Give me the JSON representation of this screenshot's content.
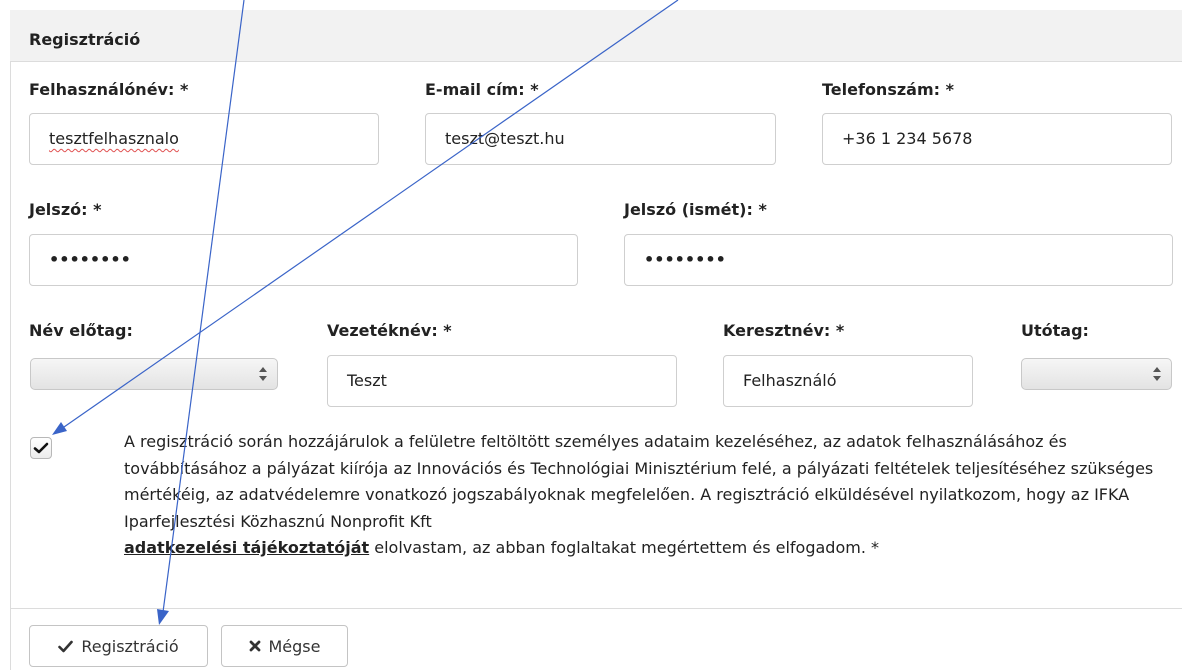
{
  "panel": {
    "title": "Regisztráció"
  },
  "fields": {
    "username": {
      "label": "Felhasználónév: *",
      "value": "tesztfelhasznalo"
    },
    "email": {
      "label": "E-mail cím: *",
      "value": "teszt@teszt.hu"
    },
    "phone": {
      "label": "Telefonszám: *",
      "value": "+36 1 234 5678"
    },
    "password": {
      "label": "Jelszó: *",
      "value": "••••••••"
    },
    "password_again": {
      "label": "Jelszó (ismét): *",
      "value": "••••••••"
    },
    "name_prefix": {
      "label": "Név előtag:",
      "value": ""
    },
    "last_name": {
      "label": "Vezetéknév: *",
      "value": "Teszt"
    },
    "first_name": {
      "label": "Keresztnév: *",
      "value": "Felhasználó"
    },
    "suffix": {
      "label": "Utótag:",
      "value": ""
    }
  },
  "consent": {
    "checked": true,
    "text_before": "A regisztráció során hozzájárulok a felületre feltöltött személyes adataim kezeléséhez, az adatok felhasználásához és továbbításához a pályázat kiírója az Innovációs és Technológiai Minisztérium felé, a pályázati feltételek teljesítéséhez szükséges mértékéig, az adatvédelemre vonatkozó jogszabályoknak megfelelően. A regisztráció elküldésével nyilatkozom, hogy az IFKA Iparfejlesztési Közhasznú Nonprofit Kft",
    "link_text": "adatkezelési tájékoztatóját",
    "text_after": "elolvastam, az abban foglaltakat megértettem és elfogadom.  *"
  },
  "buttons": {
    "register_label": "Regisztráció",
    "cancel_label": "Mégse"
  },
  "icons": {
    "check": "check-icon",
    "cancel": "x-icon",
    "select_arrows": "updown-arrows-icon"
  },
  "colors": {
    "annotation_arrow": "#3a64c8"
  }
}
